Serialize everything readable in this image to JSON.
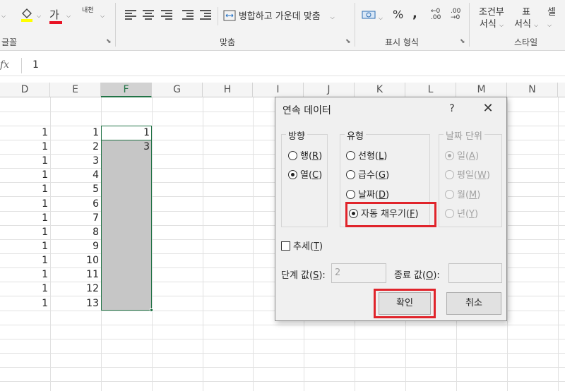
{
  "ribbon": {
    "groups": {
      "font": "글꼴",
      "alignment": "맞춤",
      "number": "표시 형식",
      "styles": "스타일"
    },
    "font_tools": {
      "font_color_glyph": "가",
      "phonetic_glyph": "내천"
    },
    "merge_center": "병합하고 가운데 맞춤",
    "number_tools": {
      "percent": "%",
      "comma": ",",
      "inc_decimal": "←0 .00",
      "dec_decimal": ".00 →0"
    },
    "conditional_format": {
      "line1": "조건부",
      "line2": "서식"
    },
    "table_format": {
      "line1": "표",
      "line2": "서식"
    },
    "cell_styles_partial": "셀"
  },
  "formula_bar": {
    "fx": "fx",
    "value": "1"
  },
  "columns": [
    "D",
    "E",
    "F",
    "G",
    "H",
    "I",
    "J",
    "K",
    "L",
    "M",
    "N"
  ],
  "grid": {
    "col_d": [
      "1",
      "1",
      "1",
      "1",
      "1",
      "1",
      "1",
      "1",
      "1",
      "1",
      "1",
      "1",
      "1"
    ],
    "col_e": [
      "1",
      "2",
      "3",
      "4",
      "5",
      "6",
      "7",
      "8",
      "9",
      "10",
      "11",
      "12",
      "13"
    ],
    "col_f": [
      "1",
      "3"
    ]
  },
  "dialog": {
    "title": "연속 데이터",
    "help": "?",
    "close": "✕",
    "direction": {
      "legend": "방향",
      "row_label": "행(",
      "row_key": "R",
      "col_label": "열(",
      "col_key": "C",
      "selected": "열"
    },
    "type": {
      "legend": "유형",
      "linear": "선형(",
      "linear_key": "L",
      "growth": "급수(",
      "growth_key": "G",
      "date": "날짜(",
      "date_key": "D",
      "autofill": "자동 채우기(",
      "autofill_key": "F",
      "selected": "자동 채우기"
    },
    "date_unit": {
      "legend": "날짜 단위",
      "day": "일(",
      "day_key": "A",
      "weekday": "평일(",
      "weekday_key": "W",
      "month": "월(",
      "month_key": "M",
      "year": "년(",
      "year_key": "Y"
    },
    "trend": {
      "label": "추세(",
      "key": "T"
    },
    "step": {
      "label": "단계 값(",
      "key": "S",
      "value": "2"
    },
    "stop": {
      "label": "종료 값(",
      "key": "O",
      "value": ""
    },
    "ok": "확인",
    "cancel": "취소",
    "highlight_color": "#e0242b"
  }
}
